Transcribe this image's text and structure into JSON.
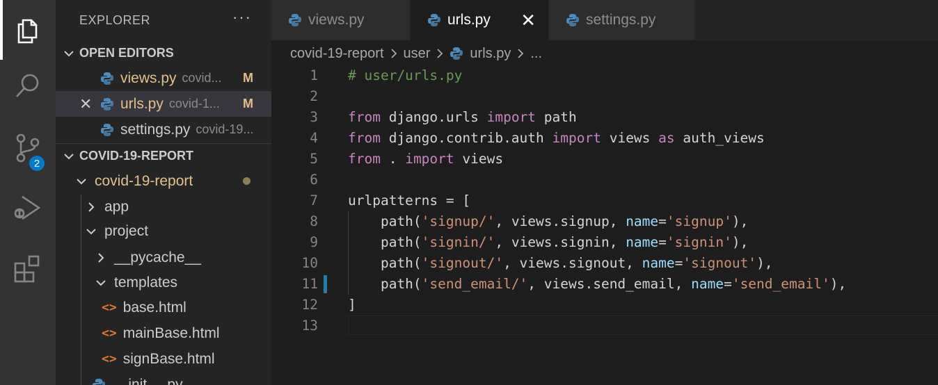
{
  "activity_bar": {
    "items": [
      {
        "icon": "explorer-icon",
        "active": true
      },
      {
        "icon": "search-icon"
      },
      {
        "icon": "source-control-icon",
        "badge": "2"
      },
      {
        "icon": "run-debug-icon"
      },
      {
        "icon": "extensions-icon"
      }
    ]
  },
  "sidebar": {
    "title": "EXPLORER",
    "more": "···",
    "open_editors": {
      "label": "OPEN EDITORS",
      "items": [
        {
          "name": "views.py",
          "desc": "covid...",
          "flag": "M"
        },
        {
          "name": "urls.py",
          "desc": "covid-1...",
          "flag": "M"
        },
        {
          "name": "settings.py",
          "desc": "covid-19..."
        }
      ]
    },
    "workspace": {
      "label": "COVID-19-REPORT",
      "tree": [
        {
          "name": "covid-19-report"
        },
        {
          "name": "app"
        },
        {
          "name": "project"
        },
        {
          "name": "__pycache__"
        },
        {
          "name": "templates"
        },
        {
          "name": "base.html"
        },
        {
          "name": "mainBase.html"
        },
        {
          "name": "signBase.html"
        },
        {
          "name": "__init__.py"
        }
      ]
    }
  },
  "tabs": [
    {
      "label": "views.py"
    },
    {
      "label": "urls.py",
      "active": true,
      "close": "✕"
    },
    {
      "label": "settings.py"
    }
  ],
  "breadcrumb": [
    "covid-19-report",
    "user",
    "urls.py",
    "..."
  ],
  "code": {
    "line_numbers": [
      "1",
      "2",
      "3",
      "4",
      "5",
      "6",
      "7",
      "8",
      "9",
      "10",
      "11",
      "12",
      "13"
    ],
    "lines": [
      [
        {
          "t": "# user/urls.py",
          "c": "cm"
        }
      ],
      [],
      [
        {
          "t": "from",
          "c": "kw"
        },
        {
          "t": " django.urls "
        },
        {
          "t": "import",
          "c": "kw"
        },
        {
          "t": " path"
        }
      ],
      [
        {
          "t": "from",
          "c": "kw"
        },
        {
          "t": " django.contrib.auth "
        },
        {
          "t": "import",
          "c": "kw"
        },
        {
          "t": " views "
        },
        {
          "t": "as",
          "c": "kw"
        },
        {
          "t": " auth_views"
        }
      ],
      [
        {
          "t": "from",
          "c": "kw"
        },
        {
          "t": " . "
        },
        {
          "t": "import",
          "c": "kw"
        },
        {
          "t": " views"
        }
      ],
      [],
      [
        {
          "t": "urlpatterns = ["
        }
      ],
      [
        {
          "t": "    path("
        },
        {
          "t": "'signup/'",
          "c": "str"
        },
        {
          "t": ", views.signup, "
        },
        {
          "t": "name",
          "c": "prm"
        },
        {
          "t": "="
        },
        {
          "t": "'signup'",
          "c": "str"
        },
        {
          "t": "),"
        }
      ],
      [
        {
          "t": "    path("
        },
        {
          "t": "'signin/'",
          "c": "str"
        },
        {
          "t": ", views.signin, "
        },
        {
          "t": "name",
          "c": "prm"
        },
        {
          "t": "="
        },
        {
          "t": "'signin'",
          "c": "str"
        },
        {
          "t": "),"
        }
      ],
      [
        {
          "t": "    path("
        },
        {
          "t": "'signout/'",
          "c": "str"
        },
        {
          "t": ", views.signout, "
        },
        {
          "t": "name",
          "c": "prm"
        },
        {
          "t": "="
        },
        {
          "t": "'signout'",
          "c": "str"
        },
        {
          "t": "),"
        }
      ],
      [
        {
          "t": "    path("
        },
        {
          "t": "'send_email/'",
          "c": "str"
        },
        {
          "t": ", views.send_email, "
        },
        {
          "t": "name",
          "c": "prm"
        },
        {
          "t": "="
        },
        {
          "t": "'send_email'",
          "c": "str"
        },
        {
          "t": "),"
        }
      ],
      [
        {
          "t": "]"
        }
      ],
      []
    ]
  },
  "colors": {
    "keyword": "#c586c0",
    "string": "#ce9178",
    "param": "#9cdcfe",
    "comment": "#6a9955",
    "modified": "#e2c08d",
    "accent": "#007acc"
  }
}
